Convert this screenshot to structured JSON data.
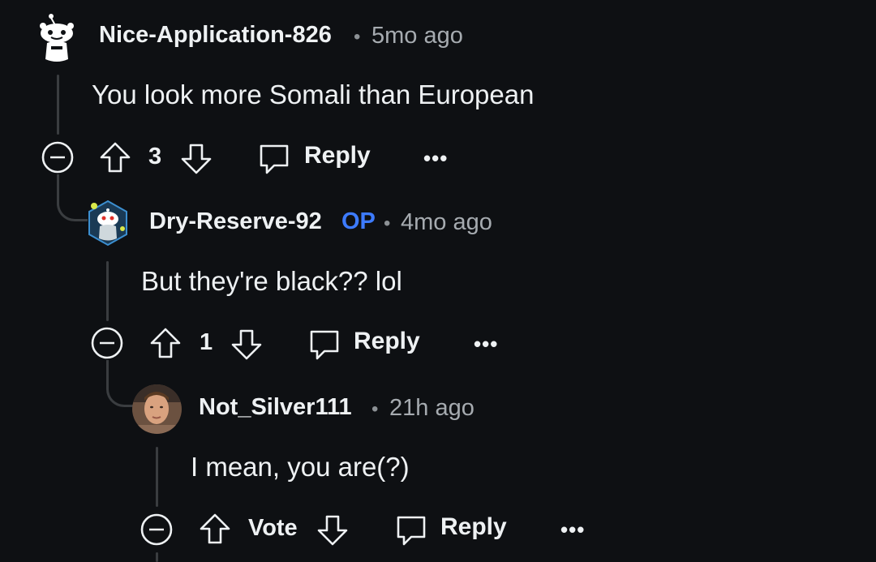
{
  "comments": [
    {
      "username": "Nice-Application-826",
      "separator": "•",
      "time": "5mo ago",
      "body": "You look more Somali than European",
      "score": "3",
      "reply_label": "Reply",
      "more_label": "•••",
      "avatar_icon": "snoo-avatar-default"
    },
    {
      "username": "Dry-Reserve-92",
      "badge": "OP",
      "separator": "•",
      "time": "4mo ago",
      "body": "But they're black?? lol",
      "score": "1",
      "reply_label": "Reply",
      "more_label": "•••",
      "avatar_icon": "snoo-avatar-custom"
    },
    {
      "username": "Not_Silver111",
      "separator": "•",
      "time": "21h ago",
      "body": "I mean, you are(?)",
      "score": "Vote",
      "reply_label": "Reply",
      "more_label": "•••",
      "avatar_icon": "photo-avatar"
    }
  ],
  "colors": {
    "background": "#0e1013",
    "text": "#eef1f3",
    "meta": "#a6abb0",
    "op_badge": "#3d7bff",
    "thread_line": "#3a3d40"
  }
}
